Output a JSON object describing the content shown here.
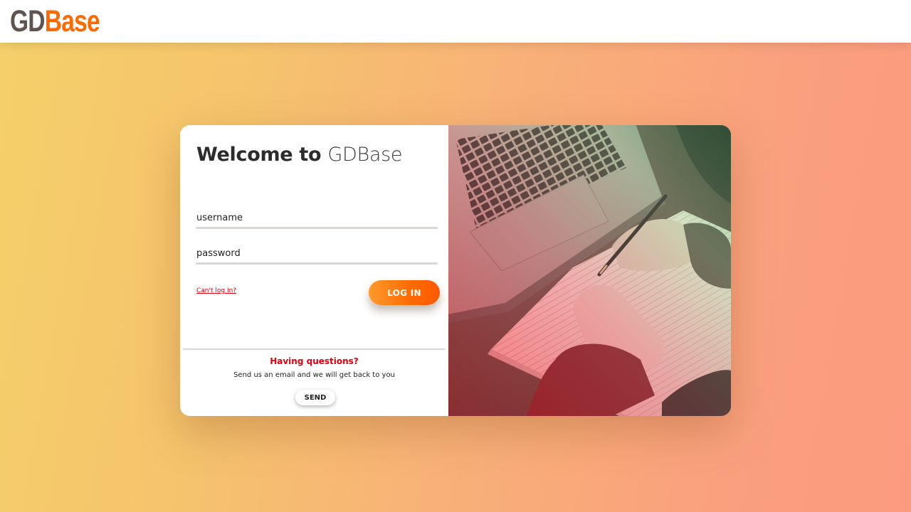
{
  "header": {
    "logo_part1": "GD",
    "logo_part2": "Base"
  },
  "login": {
    "title_strong": "Welcome to",
    "title_light": "GDBase",
    "username_placeholder": "username",
    "password_placeholder": "password",
    "cant_login": "Can't log In?",
    "login_button": "LOG IN"
  },
  "support": {
    "heading": "Having questions?",
    "text": "Send us an email and we will get back to you",
    "send_button": "SEND"
  },
  "colors": {
    "accent": "#ff6a00",
    "link": "#e0000f",
    "logo_gray": "#5f5450"
  },
  "image": {
    "description_icon": "laptop-writing-photo"
  }
}
